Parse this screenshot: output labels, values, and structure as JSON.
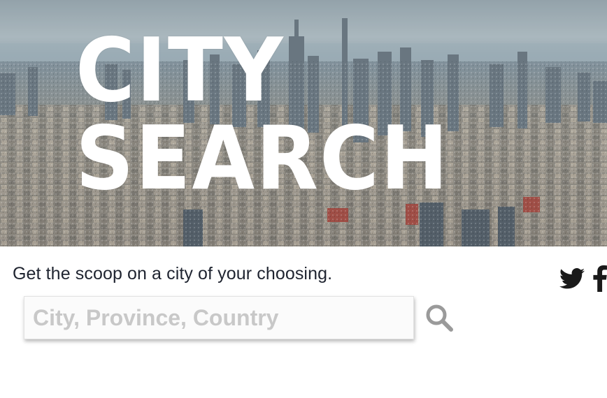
{
  "hero": {
    "logo_text": "CITY SEARCH",
    "logo_color": "#ffffff",
    "background": "city-skyline-photo"
  },
  "tagline": "Get the scoop on a city of your choosing.",
  "search": {
    "placeholder": "City, Province, Country",
    "value": "",
    "icon": "search-icon",
    "icon_color": "#9a9a9a"
  },
  "social": [
    {
      "icon": "twitter-icon",
      "color": "#1a1a1a"
    },
    {
      "icon": "facebook-icon",
      "color": "#1a1a1a"
    }
  ]
}
